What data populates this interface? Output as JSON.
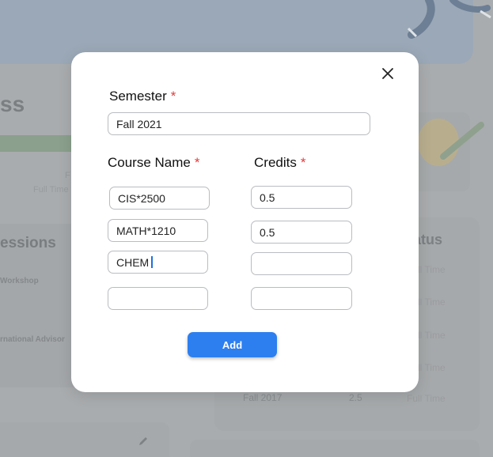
{
  "modal": {
    "close_icon": "close-icon",
    "semester_label": "Semester",
    "required_mark": "*",
    "semester_value": "Fall 2021",
    "course_name_label": "Course Name",
    "credits_label": "Credits",
    "rows": [
      {
        "course": "CIS*2500",
        "credits": "0.5"
      },
      {
        "course": "MATH*1210",
        "credits": "0.5"
      },
      {
        "course": "CHEM",
        "credits": ""
      },
      {
        "course": "",
        "credits": ""
      }
    ],
    "add_label": "Add",
    "accent_color": "#2d7ff0",
    "required_color": "#e33b3b"
  },
  "background": {
    "title_fragment": "ss",
    "sessions_title": "essions",
    "session_items": [
      "Workshop",
      "rnational Advisor"
    ],
    "status_title": "atus",
    "term": "Fall 2017",
    "credits_value": "2.5",
    "status_values": [
      "Full Time",
      "Full Time",
      "Full Time",
      "Full Time",
      "Full Time"
    ],
    "faint_texts": [
      "F",
      "Full Time"
    ],
    "edit_icon": "pencil-icon"
  }
}
